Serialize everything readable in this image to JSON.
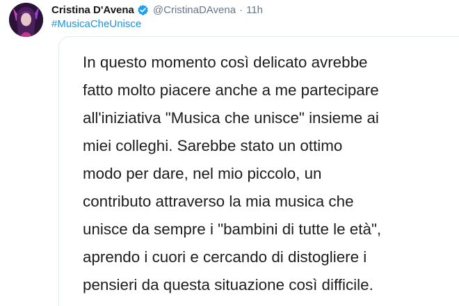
{
  "tweet": {
    "author": {
      "display_name": "Cristina D'Avena",
      "handle": "@CristinaDAvena",
      "verified": true,
      "avatar_icon": "avatar-photo"
    },
    "separator": "·",
    "time": "11h",
    "hashtag": "#MusicaCheUnisce",
    "image_text": "In questo momento così delicato avrebbe\nfatto molto piacere anche a me partecipare\nall'iniziativa \"Musica che unisce\" insieme ai\nmiei colleghi. Sarebbe stato un ottimo\nmodo per dare, nel mio piccolo, un\ncontributo attraverso la mia musica che\nunisce da sempre i \"bambini di tutte le età\",\naprendo i cuori e cercando di distogliere i\npensieri da questa situazione così difficile."
  },
  "colors": {
    "link": "#1b95e0",
    "muted": "#657786",
    "verified_badge": "#1da1f2"
  }
}
